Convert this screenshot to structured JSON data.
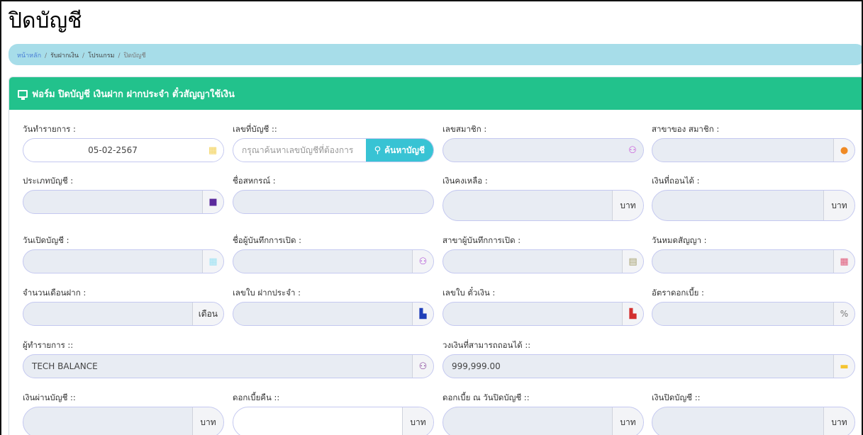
{
  "page_title": "ปิดบัญชี",
  "breadcrumb": [
    "หน้าหลัก",
    "รับฝากเงิน",
    "โปรแกรม",
    "ปิดบัญชี"
  ],
  "card_title": "ฟอร์ม ปิดบัญชี เงินฝาก ฝากประจำ ตั๋วสัญญาใช้เงิน",
  "fields": {
    "txn_date": {
      "label": "วันทำรายการ :",
      "value": "05-02-2567"
    },
    "account_no": {
      "label": "เลขที่บัญชี ::",
      "placeholder": "กรุณาค้นหาเลขบัญชีที่ต้องการ",
      "button": "ค้นหาบัญชี"
    },
    "member_no": {
      "label": "เลขสมาชิก :",
      "value": ""
    },
    "member_branch": {
      "label": "สาขาของ สมาชิก :",
      "value": ""
    },
    "account_type": {
      "label": "ประเภทบัญชี :",
      "value": ""
    },
    "coop_name": {
      "label": "ชื่อสหกรณ์ :",
      "value": ""
    },
    "balance": {
      "label": "เงินคงเหลือ :",
      "value": "",
      "unit": "บาท"
    },
    "withdrawable": {
      "label": "เงินที่ถอนได้ :",
      "value": "",
      "unit": "บาท"
    },
    "open_date": {
      "label": "วันเปิดบัญชี :",
      "value": ""
    },
    "opener_name": {
      "label": "ชื่อผู้บันทึกการเปิด :",
      "value": ""
    },
    "opener_branch": {
      "label": "สาขาผู้บันทึกการเปิด :",
      "value": ""
    },
    "contract_expiry": {
      "label": "วันหมดสัญญา :",
      "value": ""
    },
    "deposit_months": {
      "label": "จำนวนเดือนฝาก :",
      "value": "",
      "unit": "เดือน"
    },
    "fixed_slip_no": {
      "label": "เลขใบ ฝากประจำ :",
      "value": ""
    },
    "note_slip_no": {
      "label": "เลขใบ ตั๋วเงิน :",
      "value": ""
    },
    "interest_rate": {
      "label": "อัตราดอกเบี้ย :",
      "value": "",
      "unit": "%"
    },
    "operator": {
      "label": "ผู้ทำรายการ ::",
      "value": "TECH BALANCE"
    },
    "withdraw_limit": {
      "label": "วงเงินที่สามารถถอนได้ ::",
      "value": "999,999.00"
    },
    "pass_amount": {
      "label": "เงินผ่านบัญชี ::",
      "value": "",
      "unit": "บาท"
    },
    "refund_interest": {
      "label": "ดอกเบี้ยคืน ::",
      "value": "",
      "unit": "บาท"
    },
    "interest_at_close": {
      "label": "ดอกเบี้ย ณ วันปิดบัญชี ::",
      "value": "",
      "unit": "บาท"
    },
    "close_amount": {
      "label": "เงินปิดบัญชี ::",
      "value": "",
      "unit": "บาท"
    }
  },
  "colors": {
    "header": "#22c28c",
    "breadcrumb_bg": "#a7dde9",
    "search_button": "#38c3d4",
    "field_bg": "#e8ecf3"
  }
}
